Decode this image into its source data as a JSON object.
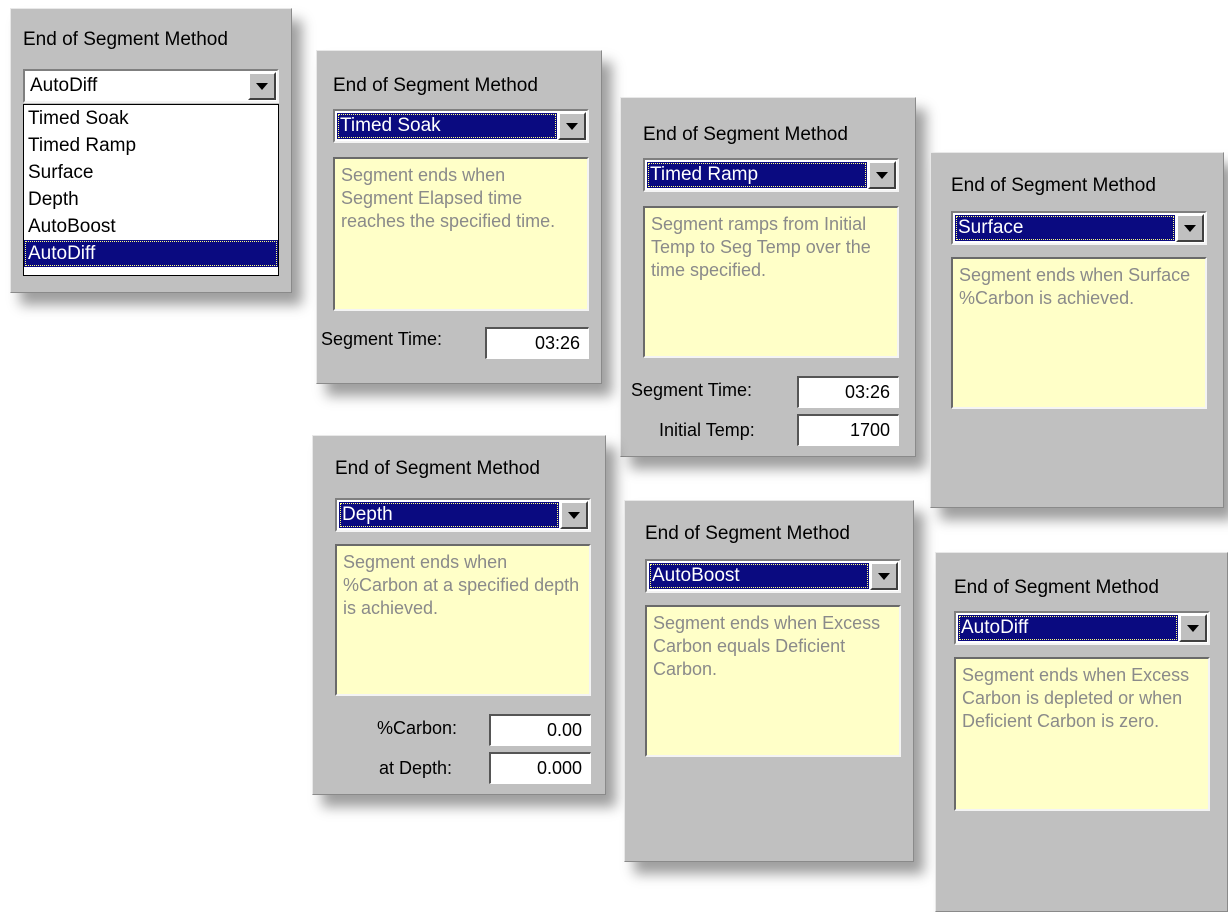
{
  "panel_title": "End of Segment Method",
  "panel1": {
    "selected": "AutoDiff",
    "options": [
      "Timed Soak",
      "Timed Ramp",
      "Surface",
      "Depth",
      "AutoBoost",
      "AutoDiff"
    ]
  },
  "panel2": {
    "selected": "Timed Soak",
    "description": "Segment ends when Segment Elapsed time reaches the specified time.",
    "segment_time_label": "Segment Time:",
    "segment_time_value": "03:26"
  },
  "panel3": {
    "selected": "Timed Ramp",
    "description": "Segment ramps from Initial Temp to Seg Temp over the time specified.",
    "segment_time_label": "Segment Time:",
    "segment_time_value": "03:26",
    "initial_temp_label": "Initial Temp:",
    "initial_temp_value": "1700"
  },
  "panel4": {
    "selected": "Surface",
    "description": "Segment ends when Surface %Carbon is achieved."
  },
  "panel5": {
    "selected": "Depth",
    "description": "Segment ends when %Carbon at a specified depth is achieved.",
    "carbon_label": "%Carbon:",
    "carbon_value": "0.00",
    "depth_label": "at Depth:",
    "depth_value": "0.000"
  },
  "panel6": {
    "selected": "AutoBoost",
    "description": "Segment ends when Excess Carbon equals Deficient Carbon."
  },
  "panel7": {
    "selected": "AutoDiff",
    "description": "Segment ends when Excess Carbon is depleted or when Deficient Carbon is zero."
  },
  "colors": {
    "panel_bg": "#c0c0c0",
    "selection_bg": "#0a0a80",
    "description_bg": "#ffffc8",
    "description_text": "#8a8a8a"
  },
  "icons": {
    "dropdown_arrow": "chevron-down-icon"
  }
}
